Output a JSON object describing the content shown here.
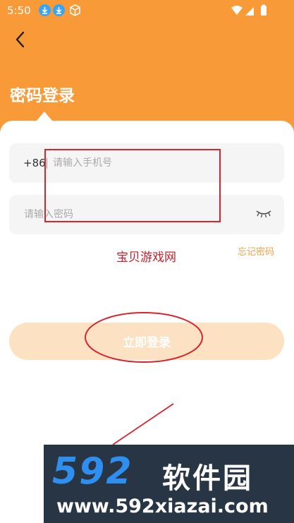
{
  "status_bar": {
    "time": "5:50"
  },
  "header": {
    "title": "密码登录",
    "back_icon": "chevron-left-icon",
    "background_color": "#f89a38"
  },
  "form": {
    "country_code": "+86",
    "phone_placeholder": "请输入手机号",
    "password_placeholder": "请输入密码",
    "password_toggle_icon": "eye-closed-icon",
    "forgot_password": "忘记密码",
    "login_button": "立即登录"
  },
  "overlay": {
    "watermark_text": "宝贝游戏网"
  },
  "banner": {
    "logo": "592",
    "brand": "软件园",
    "url": "www.592xiazai.com"
  }
}
